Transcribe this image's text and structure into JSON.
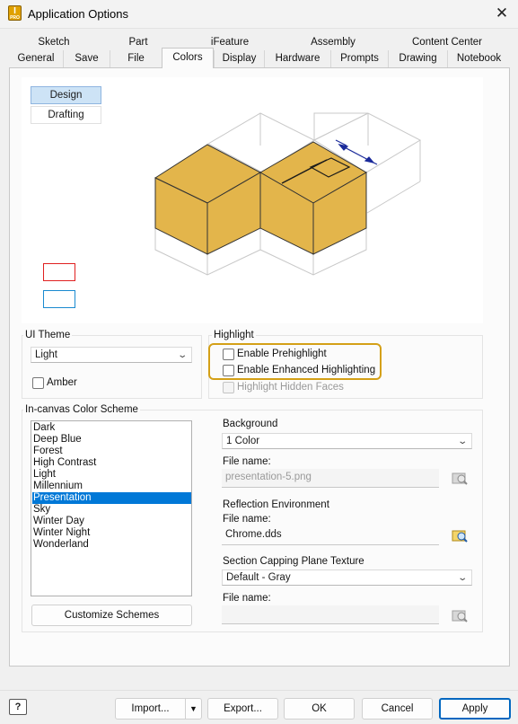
{
  "window": {
    "title": "Application Options",
    "app_icon_letter": "I",
    "app_icon_sub": "PRO",
    "close_glyph": "✕"
  },
  "tabs": {
    "row1": [
      "Sketch",
      "Part",
      "iFeature",
      "Assembly",
      "Content Center"
    ],
    "row2": [
      "General",
      "Save",
      "File",
      "Colors",
      "Display",
      "Hardware",
      "Prompts",
      "Drawing",
      "Notebook"
    ],
    "active": "Colors"
  },
  "preview": {
    "design_label": "Design",
    "drafting_label": "Drafting",
    "accent_fill": "#e3b54b"
  },
  "ui_theme": {
    "label": "UI Theme",
    "value": "Light",
    "amber_label": "Amber",
    "amber_checked": false
  },
  "highlight": {
    "label": "Highlight",
    "prehighlight": "Enable Prehighlight",
    "enhanced": "Enable Enhanced Highlighting",
    "hidden_faces": "Highlight Hidden Faces",
    "outline_color": "#d4a017"
  },
  "color_scheme": {
    "label": "In-canvas Color Scheme",
    "items": [
      "Dark",
      "Deep Blue",
      "Forest",
      "High Contrast",
      "Light",
      "Millennium",
      "Presentation",
      "Sky",
      "Winter Day",
      "Winter Night",
      "Wonderland"
    ],
    "selected": "Presentation",
    "customize_label": "Customize Schemes"
  },
  "background": {
    "label": "Background",
    "value": "1 Color",
    "file_label": "File name:",
    "file_value": "presentation-5.png"
  },
  "reflection": {
    "label": "Reflection Environment",
    "file_label": "File name:",
    "file_value": "Chrome.dds"
  },
  "section_capping": {
    "label": "Section Capping Plane Texture",
    "value": "Default - Gray",
    "file_label": "File name:",
    "file_value": ""
  },
  "footer": {
    "help": "?",
    "import": "Import...",
    "export": "Export...",
    "ok": "OK",
    "cancel": "Cancel",
    "apply": "Apply",
    "split_arrow": "▼"
  }
}
